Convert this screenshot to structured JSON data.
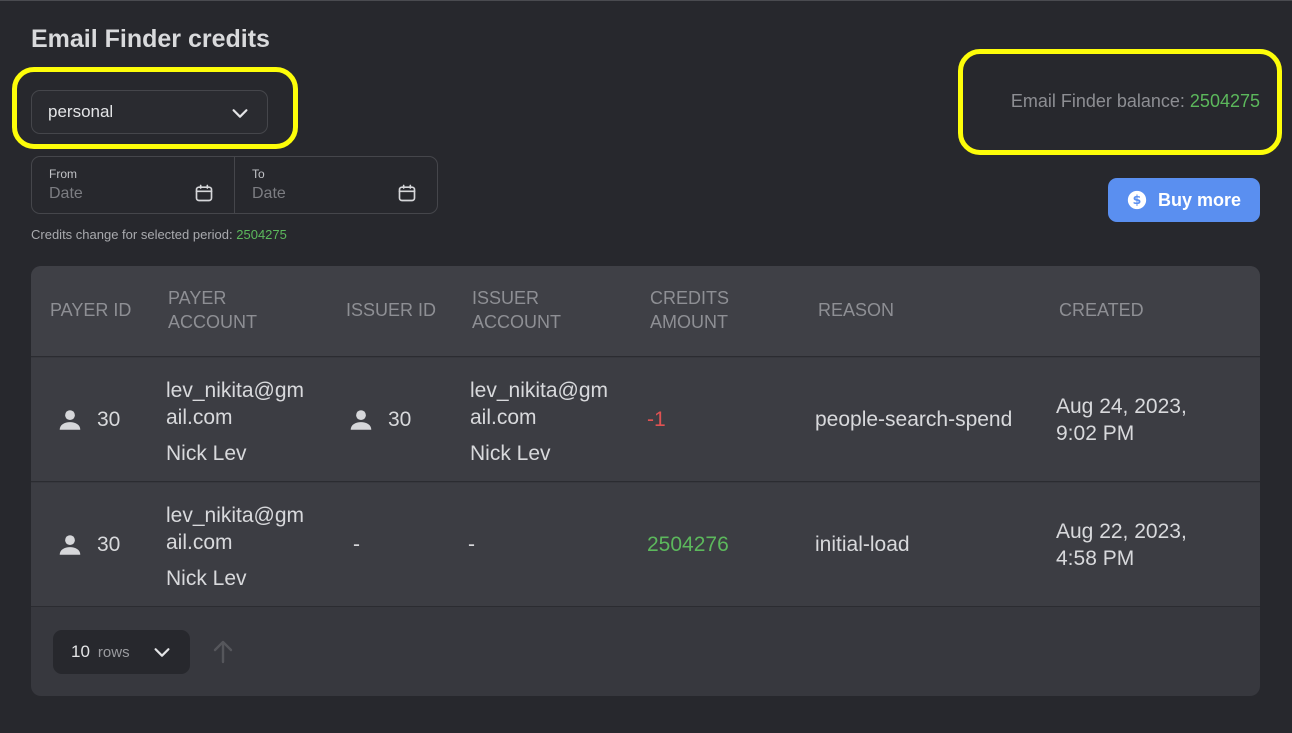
{
  "page": {
    "title": "Email Finder credits"
  },
  "account_select": {
    "value": "personal"
  },
  "date_range": {
    "from": {
      "label": "From",
      "placeholder": "Date"
    },
    "to": {
      "label": "To",
      "placeholder": "Date"
    }
  },
  "period_change": {
    "label": "Credits change for selected period:",
    "value": "2504275"
  },
  "balance": {
    "label": "Email Finder balance:",
    "value": "2504275"
  },
  "buy_button": {
    "label": "Buy more"
  },
  "table": {
    "columns": {
      "payer_id": "PAYER ID",
      "payer_account_1": "PAYER",
      "payer_account_2": "ACCOUNT",
      "issuer_id": "ISSUER ID",
      "issuer_account_1": "ISSUER",
      "issuer_account_2": "ACCOUNT",
      "credits_amount_1": "CREDITS",
      "credits_amount_2": "AMOUNT",
      "reason": "REASON",
      "created": "CREATED"
    },
    "rows": [
      {
        "payer_id": "30",
        "payer_email_1": "lev_nikita@gm",
        "payer_email_2": "ail.com",
        "payer_name": "Nick Lev",
        "issuer_id": "30",
        "issuer_email_1": "lev_nikita@gm",
        "issuer_email_2": "ail.com",
        "issuer_name": "Nick Lev",
        "amount": "-1",
        "reason": "people-search-spend",
        "created_1": "Aug 24, 2023,",
        "created_2": "9:02 PM"
      },
      {
        "payer_id": "30",
        "payer_email_1": "lev_nikita@gm",
        "payer_email_2": "ail.com",
        "payer_name": "Nick Lev",
        "issuer_id": "-",
        "issuer_account": "-",
        "amount": "2504276",
        "reason": "initial-load",
        "created_1": "Aug 22, 2023,",
        "created_2": "4:58 PM"
      }
    ]
  },
  "pagination": {
    "rows_value": "10",
    "rows_unit": "rows"
  },
  "colors": {
    "background": "#27282d",
    "highlight": "#fdfd09",
    "positive": "#5cb85c",
    "negative": "#e05252",
    "accent": "#5a8ff0"
  }
}
